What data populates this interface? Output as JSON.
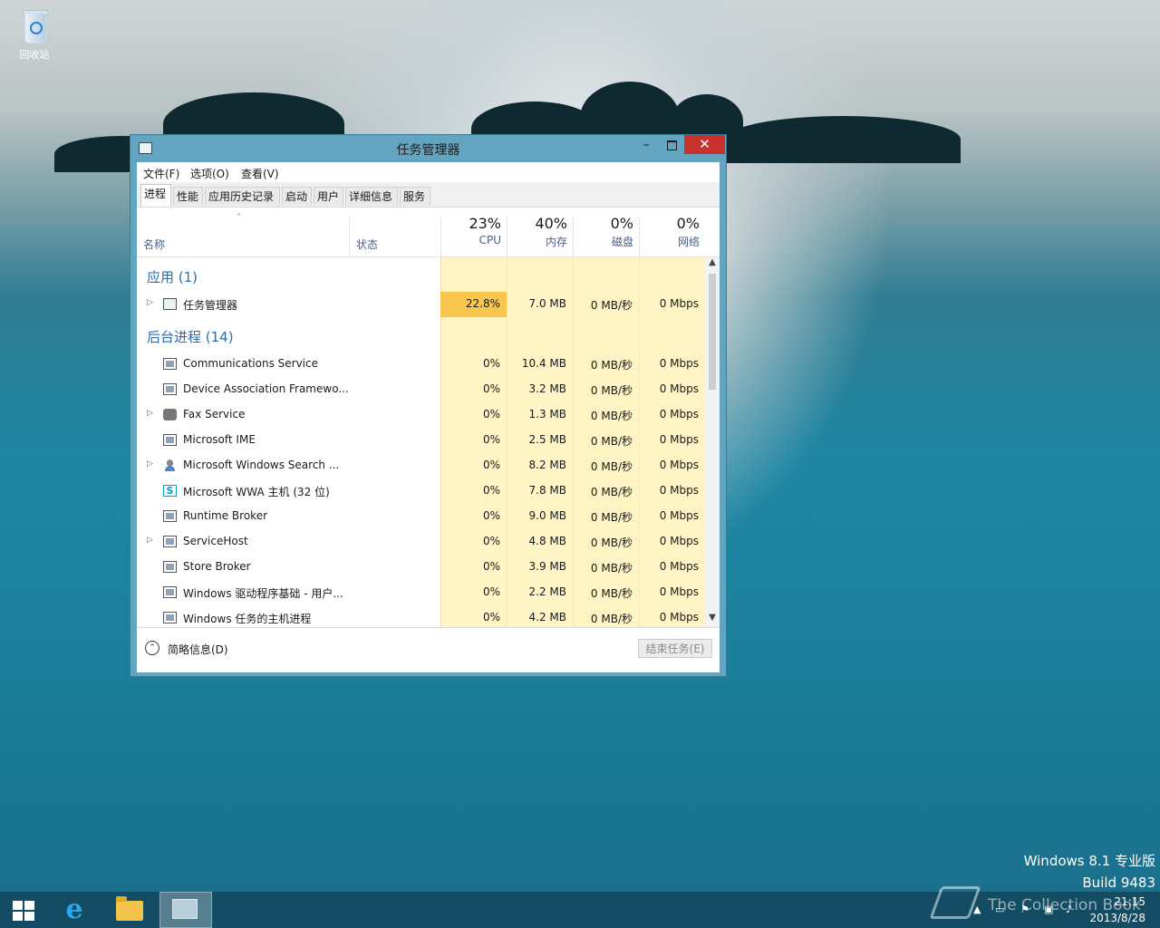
{
  "desktop": {
    "recycle_bin_label": "回收站",
    "watermark_edition": "Windows 8.1 专业版",
    "watermark_build": "Build 9483"
  },
  "window": {
    "title": "任务管理器",
    "minimize_glyph": "–",
    "close_glyph": "✕"
  },
  "menu": [
    "文件(F)",
    "选项(O)",
    "查看(V)"
  ],
  "tabs": [
    "进程",
    "性能",
    "应用历史记录",
    "启动",
    "用户",
    "详细信息",
    "服务"
  ],
  "active_tab": "进程",
  "header": {
    "sort_indicator": "˄",
    "name": "名称",
    "status": "状态",
    "metrics": [
      {
        "pct": "23%",
        "label": "CPU"
      },
      {
        "pct": "40%",
        "label": "内存"
      },
      {
        "pct": "0%",
        "label": "磁盘"
      },
      {
        "pct": "0%",
        "label": "网络"
      }
    ]
  },
  "groups": {
    "apps": "应用 (1)",
    "background": "后台进程 (14)"
  },
  "apps": [
    {
      "name": "任务管理器",
      "icon": "task-manager-icon",
      "expandable": true,
      "cpu": "22.8%",
      "mem": "7.0 MB",
      "disk": "0 MB/秒",
      "net": "0 Mbps",
      "hot": true
    }
  ],
  "background": [
    {
      "name": "Communications Service",
      "icon": "service-icon",
      "expandable": false,
      "cpu": "0%",
      "mem": "10.4 MB",
      "disk": "0 MB/秒",
      "net": "0 Mbps"
    },
    {
      "name": "Device Association Framewo...",
      "icon": "service-icon",
      "expandable": false,
      "cpu": "0%",
      "mem": "3.2 MB",
      "disk": "0 MB/秒",
      "net": "0 Mbps"
    },
    {
      "name": "Fax Service",
      "icon": "fax-icon",
      "expandable": true,
      "cpu": "0%",
      "mem": "1.3 MB",
      "disk": "0 MB/秒",
      "net": "0 Mbps"
    },
    {
      "name": "Microsoft IME",
      "icon": "service-icon",
      "expandable": false,
      "cpu": "0%",
      "mem": "2.5 MB",
      "disk": "0 MB/秒",
      "net": "0 Mbps"
    },
    {
      "name": "Microsoft Windows Search ...",
      "icon": "search-user-icon",
      "expandable": true,
      "cpu": "0%",
      "mem": "8.2 MB",
      "disk": "0 MB/秒",
      "net": "0 Mbps"
    },
    {
      "name": "Microsoft WWA 主机 (32 位)",
      "icon": "skype-icon",
      "expandable": false,
      "cpu": "0%",
      "mem": "7.8 MB",
      "disk": "0 MB/秒",
      "net": "0 Mbps"
    },
    {
      "name": "Runtime Broker",
      "icon": "service-icon",
      "expandable": false,
      "cpu": "0%",
      "mem": "9.0 MB",
      "disk": "0 MB/秒",
      "net": "0 Mbps"
    },
    {
      "name": "ServiceHost",
      "icon": "service-icon",
      "expandable": true,
      "cpu": "0%",
      "mem": "4.8 MB",
      "disk": "0 MB/秒",
      "net": "0 Mbps"
    },
    {
      "name": "Store Broker",
      "icon": "service-icon",
      "expandable": false,
      "cpu": "0%",
      "mem": "3.9 MB",
      "disk": "0 MB/秒",
      "net": "0 Mbps"
    },
    {
      "name": "Windows 驱动程序基础 - 用户...",
      "icon": "service-icon",
      "expandable": false,
      "cpu": "0%",
      "mem": "2.2 MB",
      "disk": "0 MB/秒",
      "net": "0 Mbps"
    },
    {
      "name": "Windows 任务的主机进程",
      "icon": "service-icon",
      "expandable": false,
      "cpu": "0%",
      "mem": "4.2 MB",
      "disk": "0 MB/秒",
      "net": "0 Mbps"
    }
  ],
  "footer": {
    "fewer_details": "简略信息(D)",
    "end_task": "结束任务(E)"
  },
  "taskbar": {
    "clock_time": "21:15",
    "clock_date": "2013/8/28",
    "watermark": "The Collection Book"
  },
  "colors": {
    "window_frame": "#63a5c0",
    "close_button": "#c7312e",
    "cpu_hot": "#f9c64d",
    "metric_cell": "#fff4c4",
    "group_text": "#2b6bb0"
  }
}
